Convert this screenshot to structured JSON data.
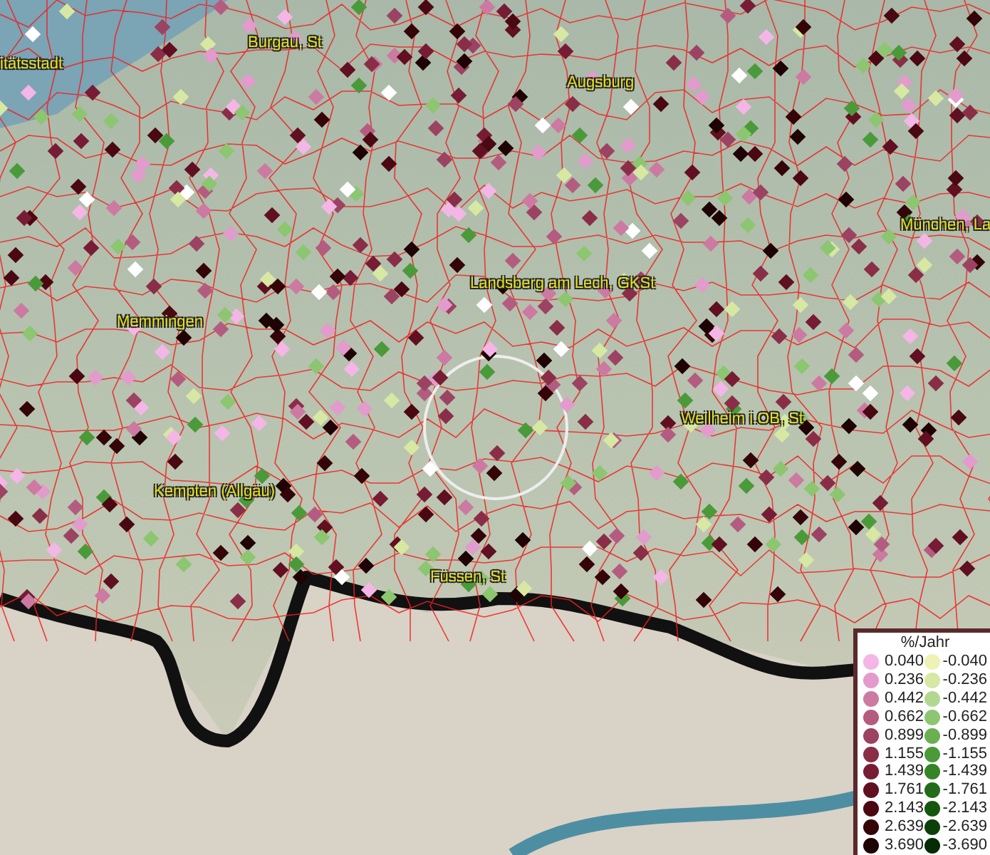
{
  "map": {
    "places": [
      {
        "name": "itätsstadt"
      },
      {
        "name": "Burgau, St"
      },
      {
        "name": "Augsburg"
      },
      {
        "name": "München, La"
      },
      {
        "name": "Landsberg am Lech, GKSt"
      },
      {
        "name": "Memmingen"
      },
      {
        "name": "Weilheim i.OB, St"
      },
      {
        "name": "Kempten (Allgäu)"
      },
      {
        "name": "Füssen, St"
      }
    ]
  },
  "legend": {
    "title": "%/Jahr",
    "positive": [
      {
        "value": "0.040",
        "color": "#f4b6e6"
      },
      {
        "value": "0.236",
        "color": "#e29bcc"
      },
      {
        "value": "0.442",
        "color": "#cc7aa2"
      },
      {
        "value": "0.662",
        "color": "#b45c80"
      },
      {
        "value": "0.899",
        "color": "#9c4262"
      },
      {
        "value": "1.155",
        "color": "#8a2e48"
      },
      {
        "value": "1.439",
        "color": "#761c34"
      },
      {
        "value": "1.761",
        "color": "#601020"
      },
      {
        "value": "2.143",
        "color": "#4a0812"
      },
      {
        "value": "2.639",
        "color": "#340408"
      },
      {
        "value": "3.690",
        "color": "#1e0204"
      }
    ],
    "negative": [
      {
        "value": "-0.040",
        "color": "#eef2b4"
      },
      {
        "value": "-0.236",
        "color": "#d6e8a2"
      },
      {
        "value": "-0.442",
        "color": "#b2d890"
      },
      {
        "value": "-0.662",
        "color": "#8cc670"
      },
      {
        "value": "-0.899",
        "color": "#6ab050"
      },
      {
        "value": "-1.155",
        "color": "#4a9a3a"
      },
      {
        "value": "-1.439",
        "color": "#358428"
      },
      {
        "value": "-1.761",
        "color": "#226c1a"
      },
      {
        "value": "-2.143",
        "color": "#14560e"
      },
      {
        "value": "-2.639",
        "color": "#0c4008"
      },
      {
        "value": "-3.690",
        "color": "#062c04"
      }
    ]
  }
}
